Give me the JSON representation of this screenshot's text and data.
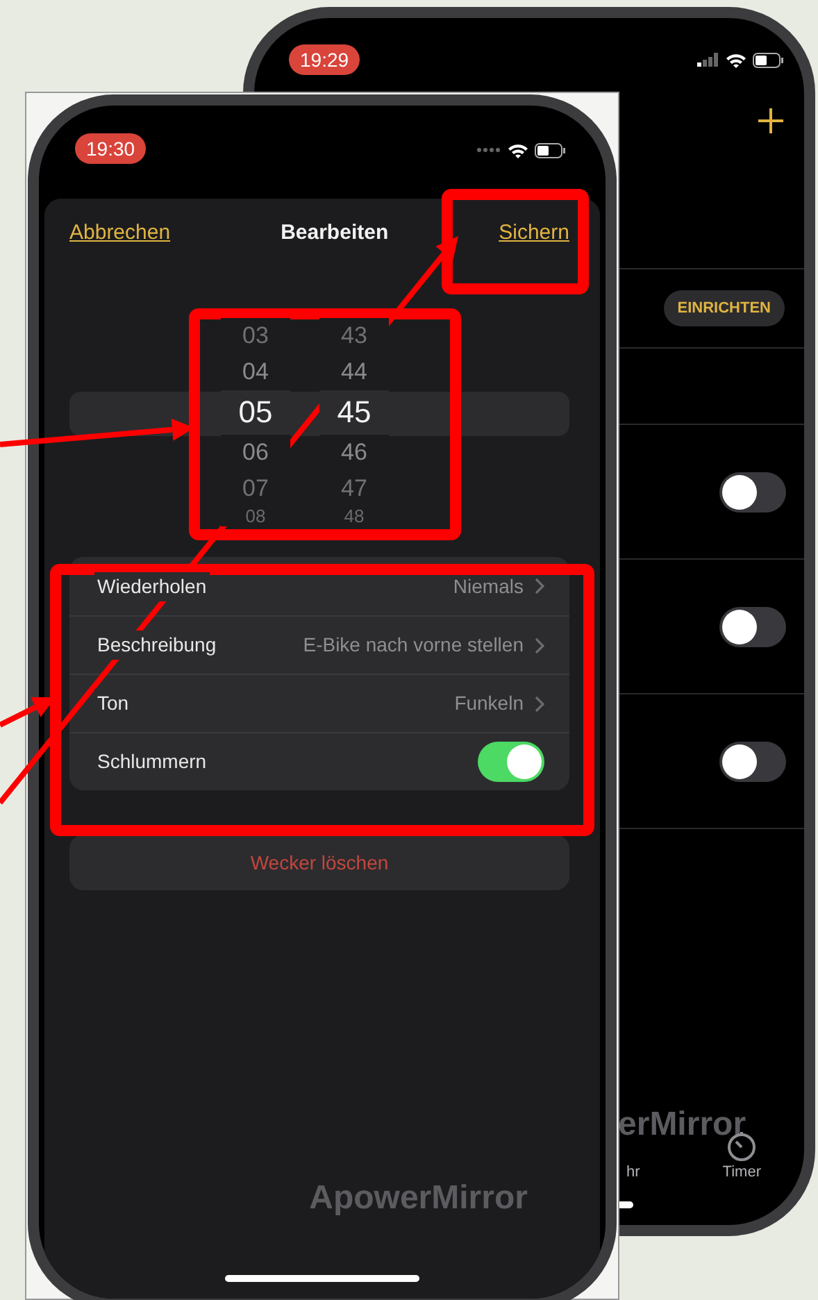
{
  "back_phone": {
    "status_time": "19:29",
    "setup_button": "EINRICHTEN",
    "alarm_toggles": [
      {
        "on": false
      },
      {
        "on": false
      },
      {
        "on": false
      }
    ],
    "watermark": "erMirror",
    "tabs": [
      {
        "label": "hr"
      },
      {
        "label": "Timer"
      }
    ]
  },
  "front_phone": {
    "status_time": "19:30",
    "cancel": "Abbrechen",
    "title": "Bearbeiten",
    "save": "Sichern",
    "picker": {
      "hours": [
        {
          "value": "03",
          "selected": false
        },
        {
          "value": "04",
          "selected": false
        },
        {
          "value": "05",
          "selected": true
        },
        {
          "value": "06",
          "selected": false
        },
        {
          "value": "07",
          "selected": false
        },
        {
          "value": "08",
          "selected": false
        }
      ],
      "minutes": [
        {
          "value": "43",
          "selected": false
        },
        {
          "value": "44",
          "selected": false
        },
        {
          "value": "45",
          "selected": true
        },
        {
          "value": "46",
          "selected": false
        },
        {
          "value": "47",
          "selected": false
        },
        {
          "value": "48",
          "selected": false
        }
      ]
    },
    "settings": [
      {
        "kind": "value",
        "label": "Wiederholen",
        "value": "Niemals"
      },
      {
        "kind": "value",
        "label": "Beschreibung",
        "value": "E-Bike nach vorne stellen"
      },
      {
        "kind": "value",
        "label": "Ton",
        "value": "Funkeln"
      },
      {
        "kind": "toggle",
        "label": "Schlummern",
        "on": true
      }
    ],
    "delete_button": "Wecker löschen",
    "watermark": "ApowerMirror"
  },
  "annotations": [
    {
      "kind": "box"
    },
    {
      "kind": "box"
    },
    {
      "kind": "box"
    },
    {
      "kind": "arrow"
    },
    {
      "kind": "arrow"
    },
    {
      "kind": "arrow"
    }
  ]
}
